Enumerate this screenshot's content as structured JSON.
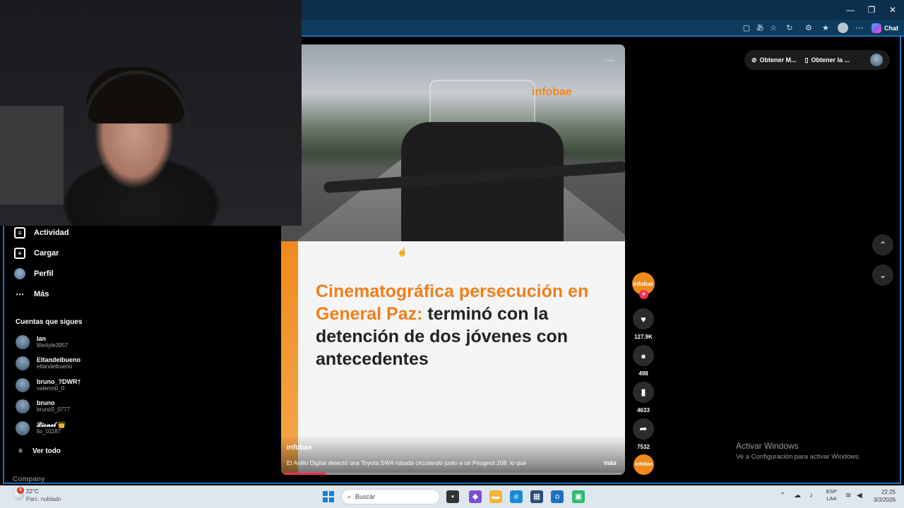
{
  "browser": {
    "window_controls": [
      "—",
      "❐",
      "✕"
    ],
    "chat_label": "Chat"
  },
  "sidebar": {
    "items": [
      {
        "label": "Actividad",
        "icon": "activity-icon"
      },
      {
        "label": "Cargar",
        "icon": "upload-icon"
      },
      {
        "label": "Perfil",
        "icon": "profile-icon"
      },
      {
        "label": "Más",
        "icon": "more-icon"
      }
    ],
    "following_title": "Cuentas que sigues",
    "accounts": [
      {
        "name": "Ian",
        "handle": "lifestyle3957"
      },
      {
        "name": "Eltandelbueno",
        "handle": "eltandelbueno"
      },
      {
        "name": "bruno_?DWR†",
        "handle": "valemn0_0"
      },
      {
        "name": "bruno",
        "handle": "bruno0_0777"
      },
      {
        "name": "𝓛𝓲𝓸𝓷𝓮𝓵 👑",
        "handle": "lio_01187"
      }
    ],
    "see_all": "Ver todo",
    "company": "Company"
  },
  "video": {
    "watermark": "infobae",
    "headline_orange": "Cinematográfica persecución en General Paz:",
    "headline_dark": " terminó con la detención de dos jóvenes con antecedentes",
    "author": "infobae",
    "description": "El Anillo Digital detectó una Toyota SW4 robada circulando junto a un Peugeot 208, lo que",
    "more": "más",
    "progress": 0.13
  },
  "actions": {
    "avatar_label": "infobae",
    "likes": "127.9K",
    "comments": "498",
    "saves": "4633",
    "shares": "7532",
    "music_label": "infobae"
  },
  "top_pill": {
    "item1": "Obtener M...",
    "item2": "Obtener la ..."
  },
  "windows": {
    "activate_title": "Activar Windows",
    "activate_sub": "Ve a Configuración para activar Windows."
  },
  "taskbar": {
    "weather_badge": "3",
    "temp": "22°C",
    "weather_desc": "Parc. nublado",
    "search_placeholder": "Buscar",
    "lang_top": "ESP",
    "lang_bottom": "LAA",
    "time": "22:25",
    "date": "3/3/2026"
  },
  "colors": {
    "accent_orange": "#f07f1b",
    "tiktok_red": "#fe2c55",
    "browser_blue": "#1e72b8"
  }
}
